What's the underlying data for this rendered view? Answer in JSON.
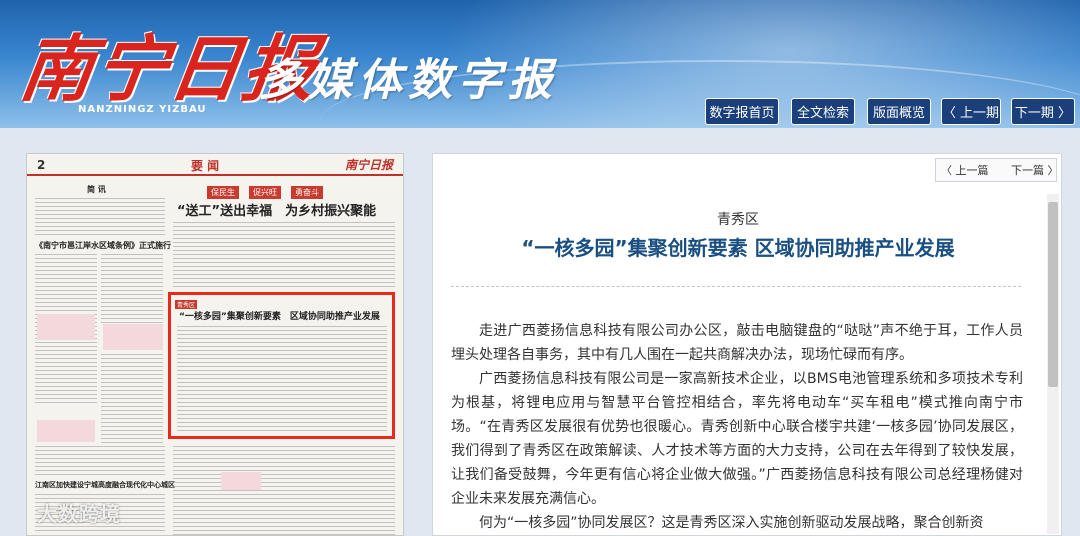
{
  "header": {
    "logo_text": "南宁日报",
    "logo_pinyin": "NANZNINGZ YIZBAU",
    "slogan": "多媒体数字报"
  },
  "nav": [
    {
      "label": "数字报首页"
    },
    {
      "label": "全文检索"
    },
    {
      "label": "版面概览"
    },
    {
      "label": "〈 上一期"
    },
    {
      "label": "下一期 〉"
    }
  ],
  "paper": {
    "page_number": "2",
    "page_name": "要 闻",
    "brand": "南宁日报",
    "brief_label": "简 讯",
    "headline_a": "《南宁市邕江岸水区域条例》正式施行",
    "banner_tags": [
      "保民生",
      "促兴旺",
      "勇奋斗"
    ],
    "main_headline": "“送工”送出幸福　为乡村振兴聚能",
    "highlight_tag": "青秀区",
    "highlight_title": "“一核多园”集聚创新要素　区域协同助推产业发展",
    "bottom_headline": "江南区加快建设宁城高度融合现代化中心城区",
    "watermark": "大数跨境"
  },
  "article": {
    "prev": "〈 上一篇",
    "next": "下一篇 〉",
    "section": "青秀区",
    "title": "“一核多园”集聚创新要素 区域协同助推产业发展",
    "paragraphs": [
      "走进广西菱扬信息科技有限公司办公区，敲击电脑键盘的“哒哒”声不绝于耳，工作人员埋头处理各自事务，其中有几人围在一起共商解决办法，现场忙碌而有序。",
      "广西菱扬信息科技有限公司是一家高新技术企业，以BMS电池管理系统和多项技术专利为根基，将锂电应用与智慧平台管控相结合，率先将电动车“买车租电”模式推向南宁市场。“在青秀区发展很有优势也很暖心。青秀创新中心联合楼宇共建‘一核多园’协同发展区，我们得到了青秀区在政策解读、人才技术等方面的大力支持，公司在去年得到了较快发展，让我们备受鼓舞，今年更有信心将企业做大做强。”广西菱扬信息科技有限公司总经理杨健对企业未来发展充满信心。",
      "何为“一核多园”协同发展区？这是青秀区深入实施创新驱动发展战略，聚合创新资"
    ]
  }
}
